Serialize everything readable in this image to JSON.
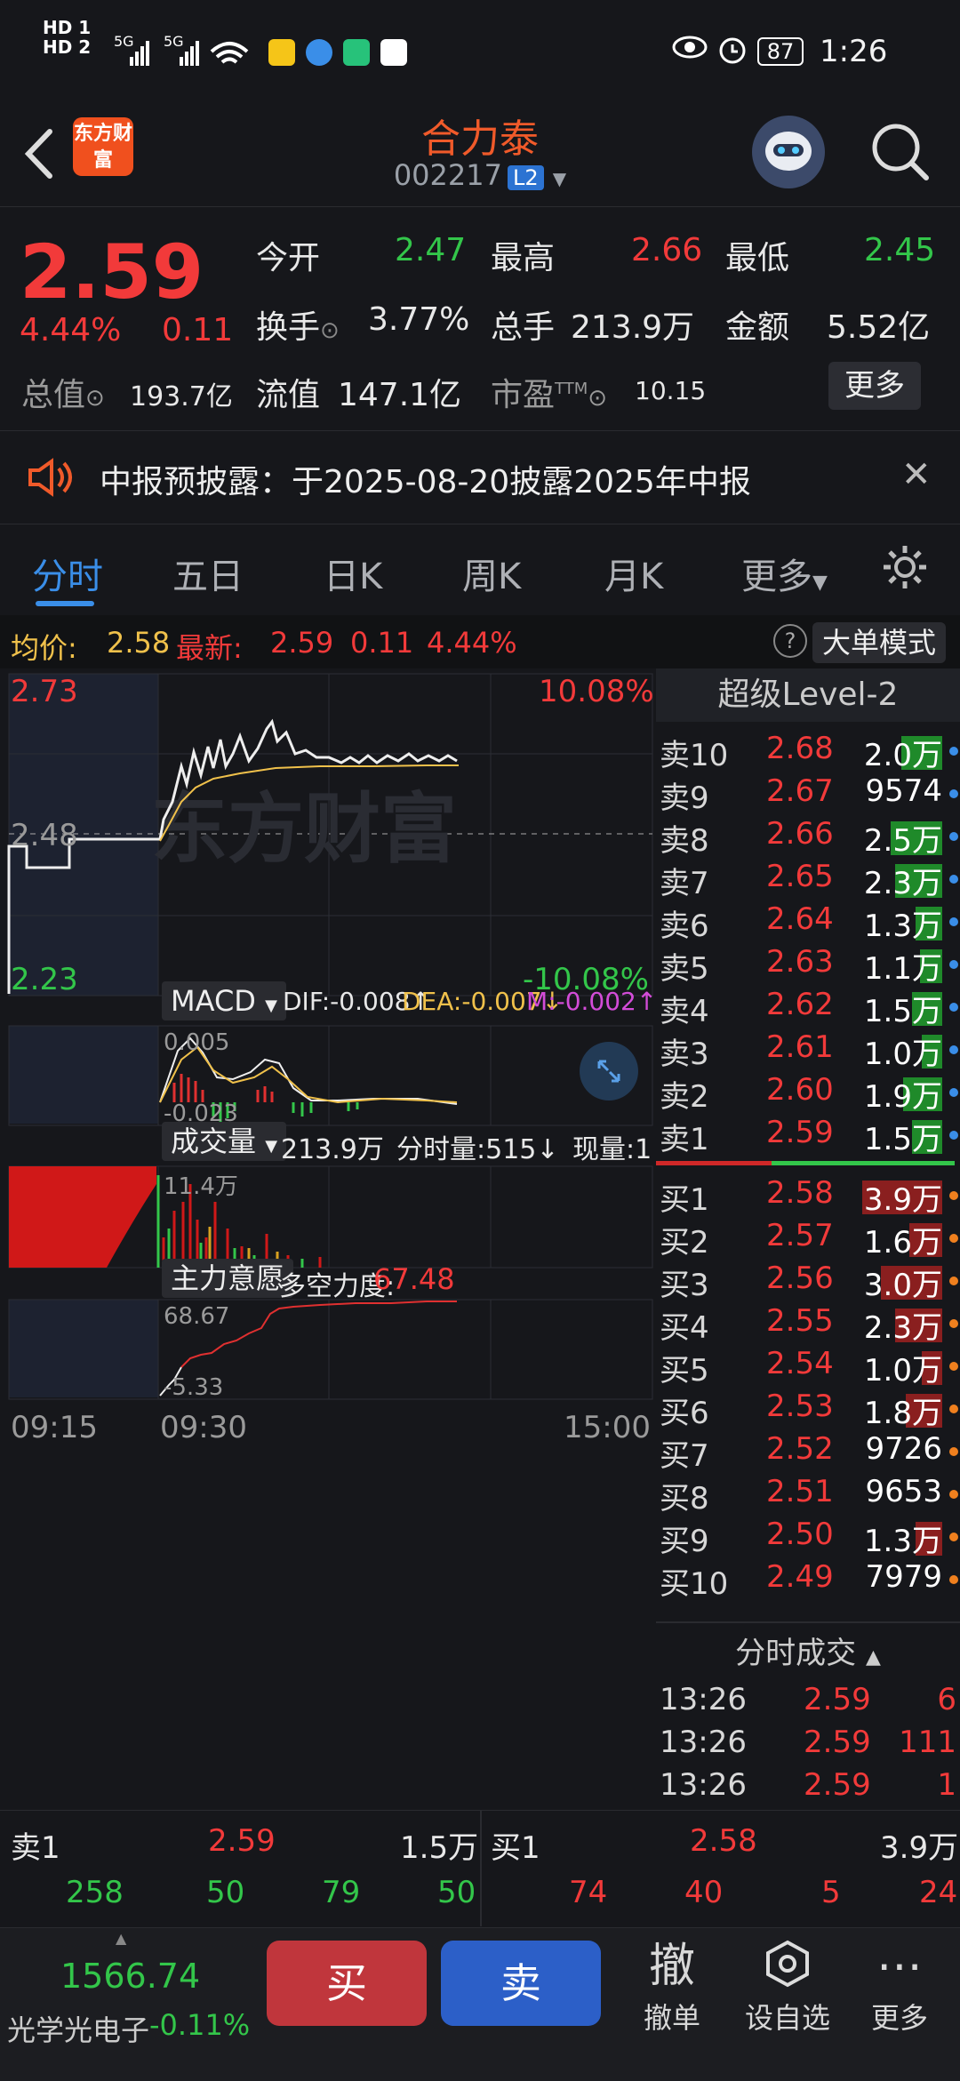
{
  "status_bar": {
    "left_icons": [
      "HD 1",
      "HD 2",
      "5G",
      "5G",
      "6",
      "wifi"
    ],
    "battery": "87",
    "time": "1:26"
  },
  "header": {
    "logo_text": "东方财富",
    "title": "合力泰",
    "code": "002217",
    "level_badge": "L2"
  },
  "quote": {
    "price": "2.59",
    "change_pct": "4.44%",
    "change": "0.11",
    "open_label": "今开",
    "open": "2.47",
    "high_label": "最高",
    "high": "2.66",
    "low_label": "最低",
    "low": "2.45",
    "turnover_label": "换手",
    "turnover": "3.77%",
    "volume_label": "总手",
    "volume": "213.9万",
    "amount_label": "金额",
    "amount": "5.52亿",
    "mktcap_label": "总值",
    "mktcap": "193.7亿",
    "float_label": "流值",
    "float": "147.1亿",
    "pe_label": "市盈",
    "pe_sup": "TTM",
    "pe": "10.15",
    "more_label": "更多"
  },
  "notice": {
    "text": "中报预披露：于2025-08-20披露2025年中报"
  },
  "tabs": [
    "分时",
    "五日",
    "日K",
    "周K",
    "月K",
    "更多"
  ],
  "active_tab": 0,
  "infobar": {
    "avg_label": "均价:",
    "avg": "2.58",
    "latest_label": "最新:",
    "latest": "2.59",
    "latest_chg": "0.11",
    "latest_pct": "4.44%",
    "mode_label": "大单模式"
  },
  "main_chart": {
    "y_max": "2.73",
    "y_mid": "2.48",
    "y_min": "2.23",
    "pct_max": "10.08%",
    "pct_min": "-10.08%",
    "watermark": "东方财富"
  },
  "macd": {
    "selector": "MACD",
    "dif": "DIF:-0.008↑",
    "dea": "DEA:-0.007↓",
    "m": "M:-0.002↑",
    "top": "0.005",
    "bottom": "-0.023"
  },
  "volume": {
    "selector": "成交量",
    "total": "213.9万",
    "minute": "分时量:515↓",
    "current": "现量:1",
    "max": "11.4万"
  },
  "intent": {
    "selector": "主力意愿",
    "label": "多空力度:",
    "value": "67.48",
    "top": "68.67",
    "bottom": "-5.33"
  },
  "time_axis": [
    "09:15",
    "09:30",
    "15:00"
  ],
  "order_book": {
    "title": "超级Level-2",
    "asks": [
      {
        "label": "卖10",
        "price": "2.68",
        "vol": "2.0万",
        "bar": 0.51
      },
      {
        "label": "卖9",
        "price": "2.67",
        "vol": "9574",
        "bar": 0
      },
      {
        "label": "卖8",
        "price": "2.66",
        "vol": "2.5万",
        "bar": 0.64
      },
      {
        "label": "卖7",
        "price": "2.65",
        "vol": "2.3万",
        "bar": 0.59
      },
      {
        "label": "卖6",
        "price": "2.64",
        "vol": "1.3万",
        "bar": 0.33
      },
      {
        "label": "卖5",
        "price": "2.63",
        "vol": "1.1万",
        "bar": 0.28
      },
      {
        "label": "卖4",
        "price": "2.62",
        "vol": "1.5万",
        "bar": 0.38
      },
      {
        "label": "卖3",
        "price": "2.61",
        "vol": "1.0万",
        "bar": 0.26
      },
      {
        "label": "卖2",
        "price": "2.60",
        "vol": "1.9万",
        "bar": 0.49
      },
      {
        "label": "卖1",
        "price": "2.59",
        "vol": "1.5万",
        "bar": 0.38
      }
    ],
    "bids": [
      {
        "label": "买1",
        "price": "2.58",
        "vol": "3.9万",
        "bar": 1.0
      },
      {
        "label": "买2",
        "price": "2.57",
        "vol": "1.6万",
        "bar": 0.41
      },
      {
        "label": "买3",
        "price": "2.56",
        "vol": "3.0万",
        "bar": 0.77
      },
      {
        "label": "买4",
        "price": "2.55",
        "vol": "2.3万",
        "bar": 0.59
      },
      {
        "label": "买5",
        "price": "2.54",
        "vol": "1.0万",
        "bar": 0.26
      },
      {
        "label": "买6",
        "price": "2.53",
        "vol": "1.8万",
        "bar": 0.46
      },
      {
        "label": "买7",
        "price": "2.52",
        "vol": "9726",
        "bar": 0
      },
      {
        "label": "买8",
        "price": "2.51",
        "vol": "9653",
        "bar": 0
      },
      {
        "label": "买9",
        "price": "2.50",
        "vol": "1.3万",
        "bar": 0.33
      },
      {
        "label": "买10",
        "price": "2.49",
        "vol": "7979",
        "bar": 0
      }
    ],
    "trades_title": "分时成交",
    "trades": [
      {
        "time": "13:26",
        "price": "2.59",
        "vol": "6"
      },
      {
        "time": "13:26",
        "price": "2.59",
        "vol": "111"
      },
      {
        "time": "13:26",
        "price": "2.59",
        "vol": "1"
      }
    ]
  },
  "summary": {
    "left": {
      "label": "卖1",
      "price": "2.59",
      "vol": "1.5万",
      "nums": [
        "258",
        "50",
        "79",
        "50"
      ]
    },
    "right": {
      "label": "买1",
      "price": "2.58",
      "vol": "3.9万",
      "nums": [
        "74",
        "40",
        "5",
        "24"
      ]
    }
  },
  "toolbar": {
    "index_value": "1566.74",
    "index_name": "光学光电子",
    "index_change": "-0.11%",
    "buy": "买",
    "sell": "卖",
    "cancel_icon": "撤",
    "cancel": "撤单",
    "watch": "设自选",
    "more": "更多"
  },
  "colors": {
    "up": "#f23a3a",
    "down": "#33c64a",
    "accent": "#3a8ee8",
    "brand": "#f0501e"
  }
}
